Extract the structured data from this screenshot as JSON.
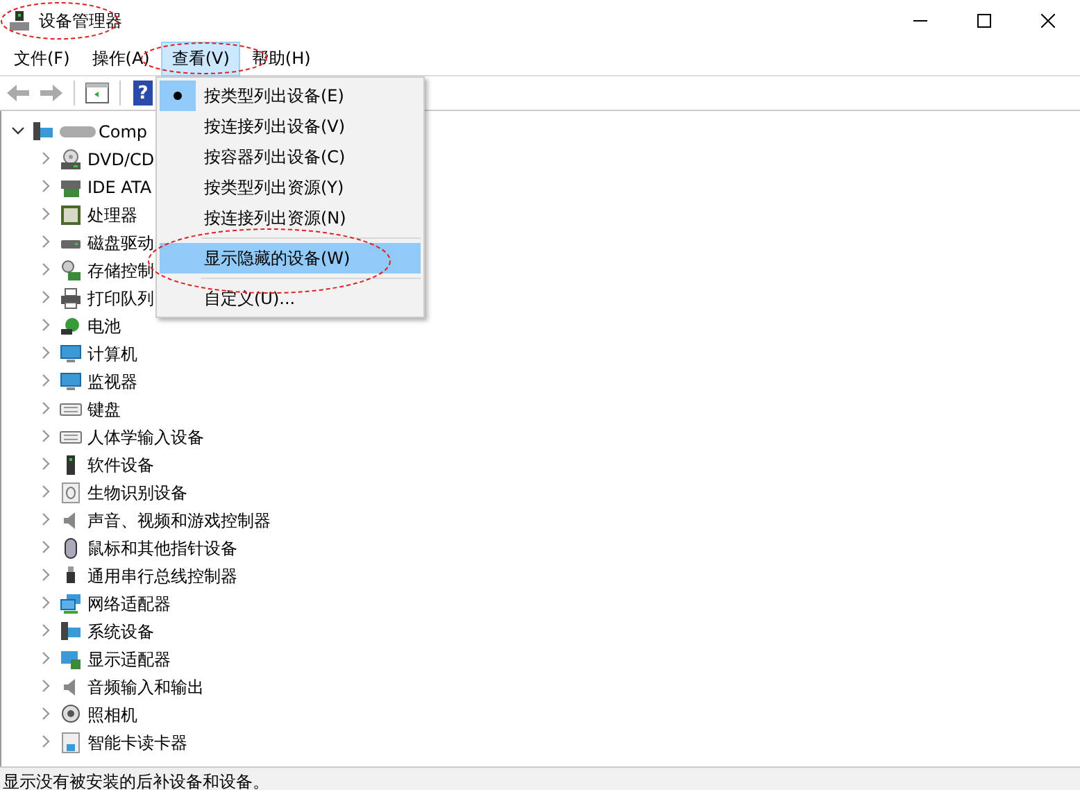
{
  "window": {
    "title": "设备管理器"
  },
  "menubar": [
    {
      "label": "文件(F)",
      "selected": false
    },
    {
      "label": "操作(A)",
      "selected": false
    },
    {
      "label": "查看(V)",
      "selected": true
    },
    {
      "label": "帮助(H)",
      "selected": false
    }
  ],
  "toolbar": [
    {
      "kind": "back",
      "disabled": true
    },
    {
      "kind": "forward",
      "disabled": true
    },
    {
      "kind": "separator"
    },
    {
      "kind": "console",
      "disabled": false
    },
    {
      "kind": "separator"
    },
    {
      "kind": "help",
      "label": "?",
      "disabled": false
    }
  ],
  "tree": {
    "label": "Comp",
    "expanded": true,
    "children": [
      {
        "label": "DVD/CD",
        "expanded": false
      },
      {
        "label": "IDE ATA",
        "expanded": false
      },
      {
        "label": "处理器",
        "expanded": false
      },
      {
        "label": "磁盘驱动",
        "expanded": false
      },
      {
        "label": "存储控制",
        "expanded": false
      },
      {
        "label": "打印队列",
        "expanded": false
      },
      {
        "label": "电池",
        "expanded": false
      },
      {
        "label": "计算机",
        "expanded": false
      },
      {
        "label": "监视器",
        "expanded": false
      },
      {
        "label": "键盘",
        "expanded": false
      },
      {
        "label": "人体学输入设备",
        "expanded": false
      },
      {
        "label": "软件设备",
        "expanded": false
      },
      {
        "label": "生物识别设备",
        "expanded": false
      },
      {
        "label": "声音、视频和游戏控制器",
        "expanded": false
      },
      {
        "label": "鼠标和其他指针设备",
        "expanded": false
      },
      {
        "label": "通用串行总线控制器",
        "expanded": false
      },
      {
        "label": "网络适配器",
        "expanded": false
      },
      {
        "label": "系统设备",
        "expanded": false
      },
      {
        "label": "显示适配器",
        "expanded": false
      },
      {
        "label": "音频输入和输出",
        "expanded": false
      },
      {
        "label": "照相机",
        "expanded": false
      },
      {
        "label": "智能卡读卡器",
        "expanded": false
      }
    ]
  },
  "view_menu": [
    {
      "kind": "item",
      "label": "按类型列出设备(E)",
      "checked": true,
      "selected": false
    },
    {
      "kind": "item",
      "label": "按连接列出设备(V)",
      "checked": false,
      "selected": false
    },
    {
      "kind": "item",
      "label": "按容器列出设备(C)",
      "checked": false,
      "selected": false
    },
    {
      "kind": "item",
      "label": "按类型列出资源(Y)",
      "checked": false,
      "selected": false
    },
    {
      "kind": "item",
      "label": "按连接列出资源(N)",
      "checked": false,
      "selected": false
    },
    {
      "kind": "separator"
    },
    {
      "kind": "item",
      "label": "显示隐藏的设备(W)",
      "checked": false,
      "selected": true
    },
    {
      "kind": "separator"
    },
    {
      "kind": "item",
      "label": "自定义(U)...",
      "checked": false,
      "selected": false
    }
  ],
  "status_bar": {
    "text": "显示没有被安装的后补设备和设备。"
  }
}
